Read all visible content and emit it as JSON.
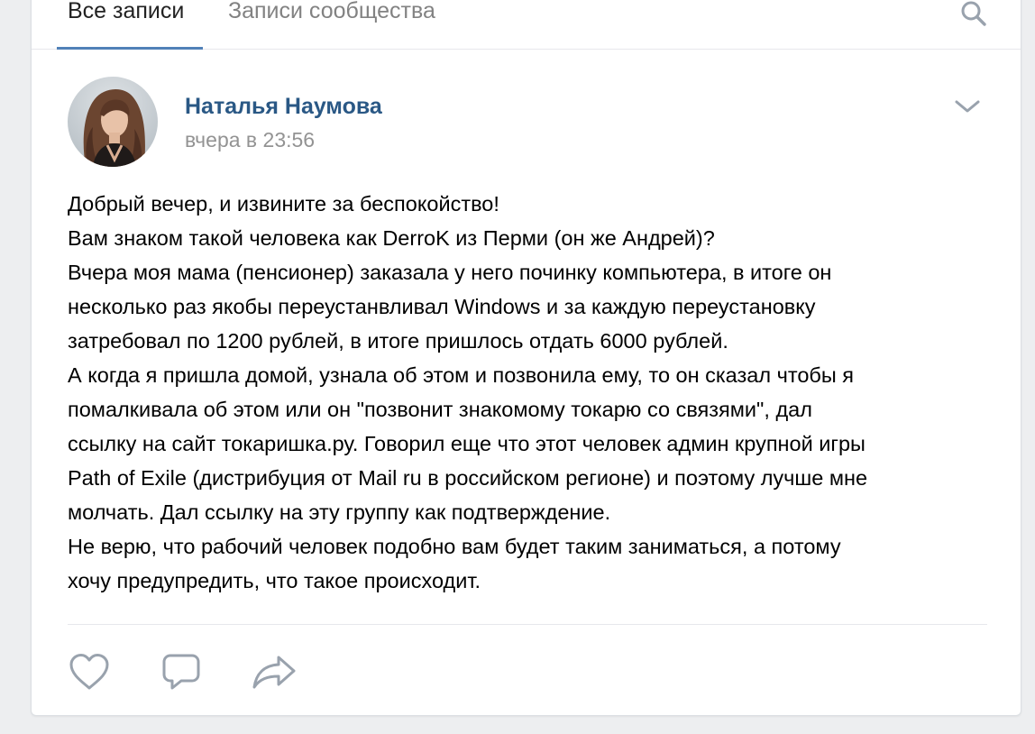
{
  "tabs": {
    "all_posts": "Все записи",
    "community_posts": "Записи сообщества"
  },
  "post": {
    "author": "Наталья Наумова",
    "date": "вчера в 23:56",
    "lines": [
      "Добрый вечер, и извините за беспокойство!",
      "Вам знаком такой человека как DerroK из Перми (он же Андрей)?",
      "Вчера моя мама (пенсионер) заказала у него починку компьютера, в итоге он",
      "несколько раз якобы переустанвливал Windows и за каждую переустановку",
      "затребовал по 1200 рублей, в итоге пришлось отдать 6000 рублей.",
      "А когда я пришла домой, узнала об этом и позвонила ему, то он сказал чтобы я",
      "помалкивала об этом или он \"позвонит знакомому токарю со связями\", дал",
      "ссылку на сайт токаришка.ру. Говорил еще что этот человек админ крупной игры",
      "Path of Exile (дистрибуция от Mail ru в российском регионе) и поэтому лучше мне",
      "молчать. Дал ссылку на эту группу как подтверждение.",
      "Не верю, что рабочий человек подобно вам будет таким заниматься, а потому",
      "хочу предупредить, что такое происходит."
    ]
  },
  "icons": {
    "search": "search-icon",
    "more": "chevron-down-icon",
    "like": "heart-icon",
    "comment": "comment-icon",
    "share": "share-arrow-icon"
  },
  "colors": {
    "accent": "#5181b8",
    "author_link": "#2a5885",
    "muted": "#939393",
    "icon_gray": "#99a2ad"
  }
}
